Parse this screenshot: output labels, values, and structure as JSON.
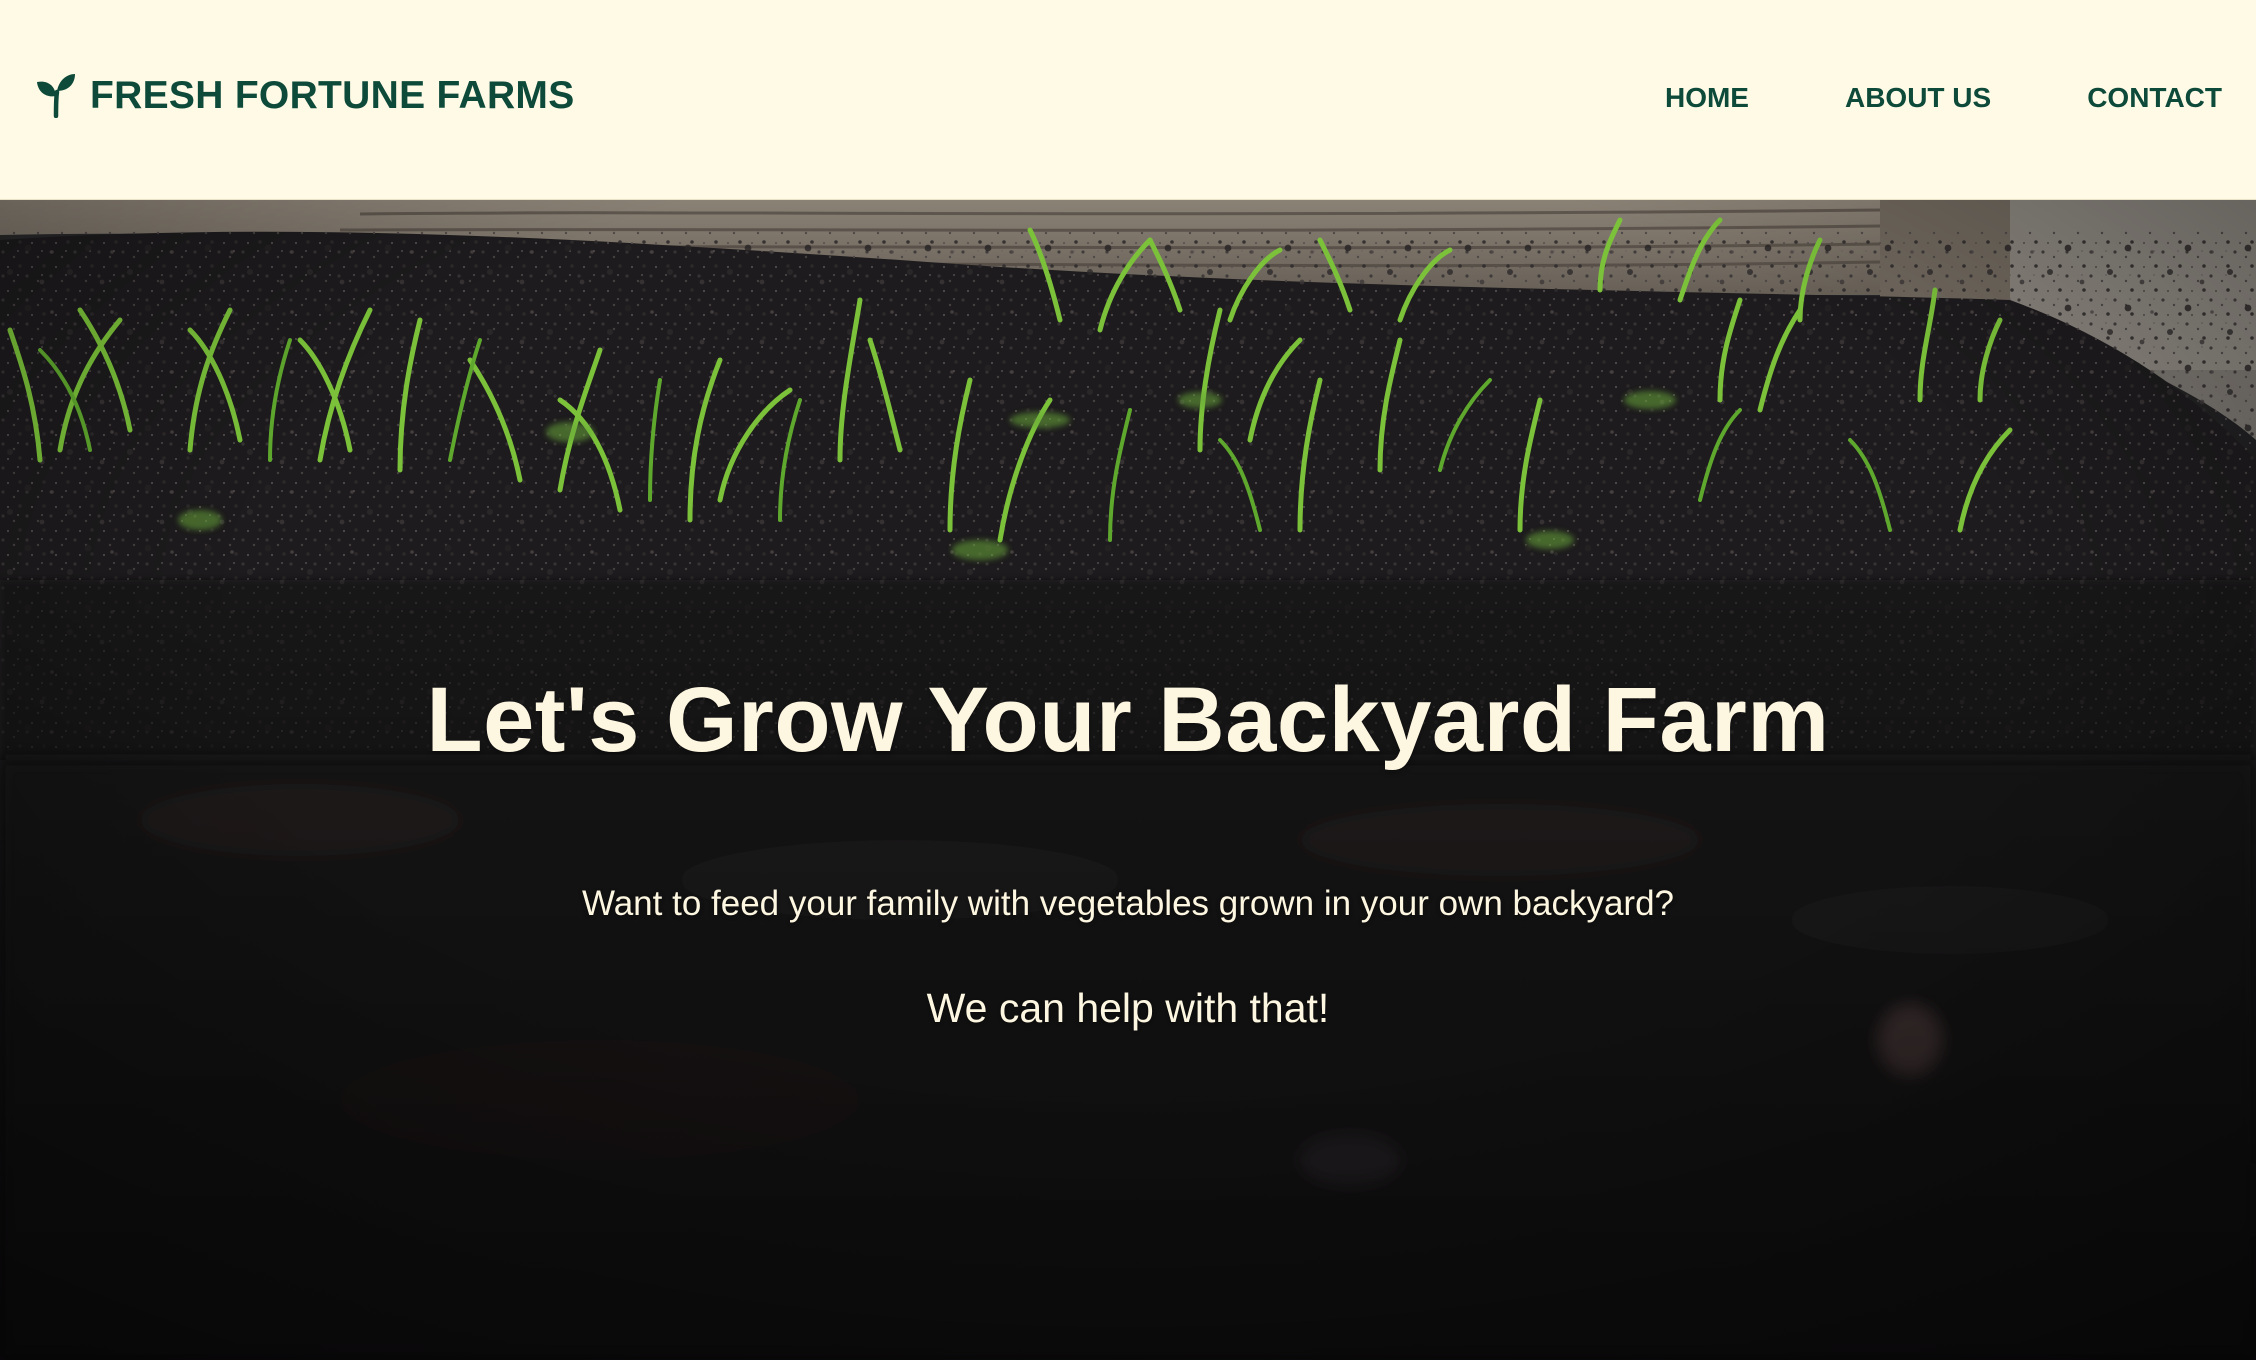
{
  "header": {
    "brand": {
      "icon": "seedling-icon",
      "name": "FRESH FORTUNE FARMS"
    },
    "nav": [
      {
        "label": "HOME"
      },
      {
        "label": "ABOUT US"
      },
      {
        "label": "CONTACT"
      }
    ]
  },
  "hero": {
    "title": "Let's Grow Your Backyard Farm",
    "subtitle": "Want to feed your family with vegetables grown in your own backyard?",
    "tagline": "We can help with that!"
  },
  "colors": {
    "header_background": "#fefae6",
    "brand_green": "#0e4a3a",
    "hero_text": "#fdf6e0"
  }
}
